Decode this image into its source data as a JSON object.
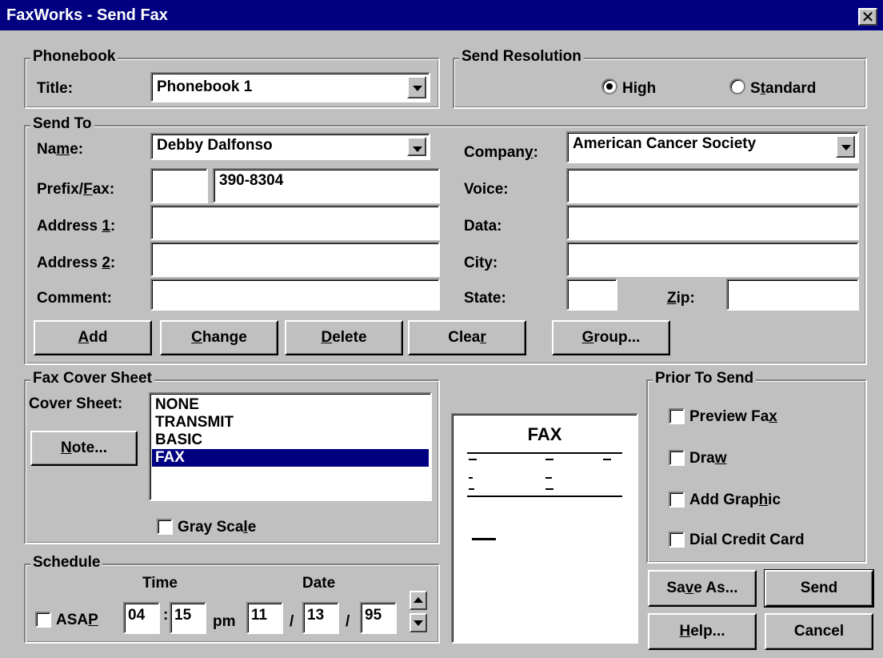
{
  "window": {
    "title": "FaxWorks - Send Fax",
    "close_glyph": "✕"
  },
  "phonebook": {
    "legend": "Phonebook",
    "title_label": "Title:",
    "title_value": "Phonebook 1"
  },
  "send_resolution": {
    "legend": "Send Resolution",
    "high_label": "High",
    "standard_pre": "S",
    "standard_u": "t",
    "standard_post": "andard",
    "selected": "High"
  },
  "send_to": {
    "legend": "Send To",
    "name_pre": "Na",
    "name_u": "m",
    "name_post": "e:",
    "name_value": "Debby Dalfonso",
    "prefix_fax_pre": "Prefix/",
    "prefix_fax_u": "F",
    "prefix_fax_post": "ax:",
    "prefix_value": "",
    "fax_value": "390-8304",
    "address1_pre": "Address ",
    "address1_u": "1",
    "address1_post": ":",
    "address1_value": "",
    "address2_pre": "Address ",
    "address2_u": "2",
    "address2_post": ":",
    "address2_value": "",
    "comment_label": "Comment:",
    "comment_value": "",
    "company_pre": "Compan",
    "company_u": "y",
    "company_post": ":",
    "company_value": "American Cancer Society",
    "voice_label": "Voice:",
    "voice_value": "",
    "data_label": "Data:",
    "data_value": "",
    "city_label": "City:",
    "city_value": "",
    "state_label": "State:",
    "state_value": "",
    "zip_u": "Z",
    "zip_post": "ip:",
    "zip_value": "",
    "buttons": {
      "add_u": "A",
      "add_post": "dd",
      "change_u": "C",
      "change_post": "hange",
      "delete_u": "D",
      "delete_post": "elete",
      "clear_pre": "Clea",
      "clear_u": "r",
      "group_u": "G",
      "group_post": "roup..."
    }
  },
  "cover_sheet": {
    "legend": "Fax Cover Sheet",
    "label": "Cover Sheet:",
    "options": [
      "NONE",
      "TRANSMIT",
      "BASIC",
      "FAX"
    ],
    "selected_index": 3,
    "note_u": "N",
    "note_post": "ote...",
    "gray_pre": "Gray Sca",
    "gray_u": "l",
    "gray_post": "e",
    "gray_checked": false
  },
  "preview": {
    "heading": "FAX"
  },
  "prior_to_send": {
    "legend": "Prior To Send",
    "preview_pre": "Preview Fa",
    "preview_u": "x",
    "draw_pre": "Dra",
    "draw_u": "w",
    "add_graphic_pre": "Add Grap",
    "add_graphic_u": "h",
    "add_graphic_post": "ic",
    "dial_credit_label": "Dial Credit Card"
  },
  "schedule": {
    "legend": "Schedule",
    "time_label": "Time",
    "date_label": "Date",
    "asap_pre": "ASA",
    "asap_u": "P",
    "hour": "04",
    "minute": "15",
    "ampm": "pm",
    "month": "11",
    "day": "13",
    "year": "95",
    "time_sep": ":",
    "date_sep": "/"
  },
  "actions": {
    "save_pre": "Sa",
    "save_u": "v",
    "save_post": "e As...",
    "send_label": "Send",
    "help_u": "H",
    "help_post": "elp...",
    "cancel_label": "Cancel"
  }
}
